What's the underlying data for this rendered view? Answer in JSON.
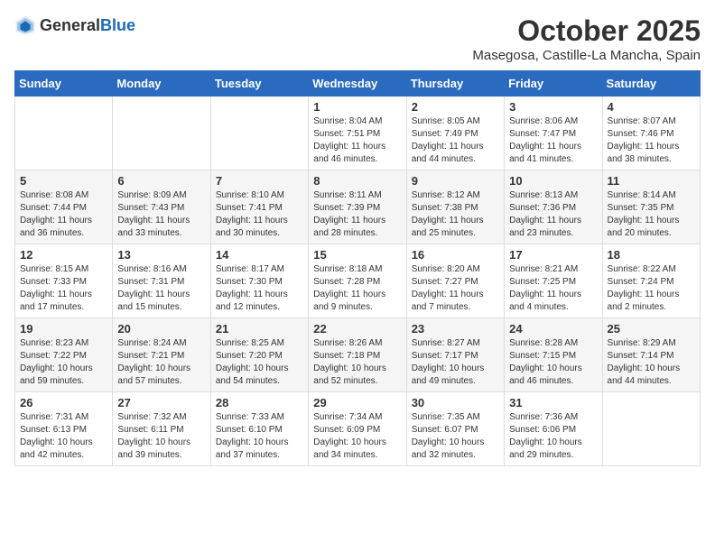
{
  "header": {
    "logo_general": "General",
    "logo_blue": "Blue",
    "title": "October 2025",
    "subtitle": "Masegosa, Castille-La Mancha, Spain"
  },
  "days_of_week": [
    "Sunday",
    "Monday",
    "Tuesday",
    "Wednesday",
    "Thursday",
    "Friday",
    "Saturday"
  ],
  "weeks": [
    [
      {
        "day": "",
        "info": ""
      },
      {
        "day": "",
        "info": ""
      },
      {
        "day": "",
        "info": ""
      },
      {
        "day": "1",
        "info": "Sunrise: 8:04 AM\nSunset: 7:51 PM\nDaylight: 11 hours and 46 minutes."
      },
      {
        "day": "2",
        "info": "Sunrise: 8:05 AM\nSunset: 7:49 PM\nDaylight: 11 hours and 44 minutes."
      },
      {
        "day": "3",
        "info": "Sunrise: 8:06 AM\nSunset: 7:47 PM\nDaylight: 11 hours and 41 minutes."
      },
      {
        "day": "4",
        "info": "Sunrise: 8:07 AM\nSunset: 7:46 PM\nDaylight: 11 hours and 38 minutes."
      }
    ],
    [
      {
        "day": "5",
        "info": "Sunrise: 8:08 AM\nSunset: 7:44 PM\nDaylight: 11 hours and 36 minutes."
      },
      {
        "day": "6",
        "info": "Sunrise: 8:09 AM\nSunset: 7:43 PM\nDaylight: 11 hours and 33 minutes."
      },
      {
        "day": "7",
        "info": "Sunrise: 8:10 AM\nSunset: 7:41 PM\nDaylight: 11 hours and 30 minutes."
      },
      {
        "day": "8",
        "info": "Sunrise: 8:11 AM\nSunset: 7:39 PM\nDaylight: 11 hours and 28 minutes."
      },
      {
        "day": "9",
        "info": "Sunrise: 8:12 AM\nSunset: 7:38 PM\nDaylight: 11 hours and 25 minutes."
      },
      {
        "day": "10",
        "info": "Sunrise: 8:13 AM\nSunset: 7:36 PM\nDaylight: 11 hours and 23 minutes."
      },
      {
        "day": "11",
        "info": "Sunrise: 8:14 AM\nSunset: 7:35 PM\nDaylight: 11 hours and 20 minutes."
      }
    ],
    [
      {
        "day": "12",
        "info": "Sunrise: 8:15 AM\nSunset: 7:33 PM\nDaylight: 11 hours and 17 minutes."
      },
      {
        "day": "13",
        "info": "Sunrise: 8:16 AM\nSunset: 7:31 PM\nDaylight: 11 hours and 15 minutes."
      },
      {
        "day": "14",
        "info": "Sunrise: 8:17 AM\nSunset: 7:30 PM\nDaylight: 11 hours and 12 minutes."
      },
      {
        "day": "15",
        "info": "Sunrise: 8:18 AM\nSunset: 7:28 PM\nDaylight: 11 hours and 9 minutes."
      },
      {
        "day": "16",
        "info": "Sunrise: 8:20 AM\nSunset: 7:27 PM\nDaylight: 11 hours and 7 minutes."
      },
      {
        "day": "17",
        "info": "Sunrise: 8:21 AM\nSunset: 7:25 PM\nDaylight: 11 hours and 4 minutes."
      },
      {
        "day": "18",
        "info": "Sunrise: 8:22 AM\nSunset: 7:24 PM\nDaylight: 11 hours and 2 minutes."
      }
    ],
    [
      {
        "day": "19",
        "info": "Sunrise: 8:23 AM\nSunset: 7:22 PM\nDaylight: 10 hours and 59 minutes."
      },
      {
        "day": "20",
        "info": "Sunrise: 8:24 AM\nSunset: 7:21 PM\nDaylight: 10 hours and 57 minutes."
      },
      {
        "day": "21",
        "info": "Sunrise: 8:25 AM\nSunset: 7:20 PM\nDaylight: 10 hours and 54 minutes."
      },
      {
        "day": "22",
        "info": "Sunrise: 8:26 AM\nSunset: 7:18 PM\nDaylight: 10 hours and 52 minutes."
      },
      {
        "day": "23",
        "info": "Sunrise: 8:27 AM\nSunset: 7:17 PM\nDaylight: 10 hours and 49 minutes."
      },
      {
        "day": "24",
        "info": "Sunrise: 8:28 AM\nSunset: 7:15 PM\nDaylight: 10 hours and 46 minutes."
      },
      {
        "day": "25",
        "info": "Sunrise: 8:29 AM\nSunset: 7:14 PM\nDaylight: 10 hours and 44 minutes."
      }
    ],
    [
      {
        "day": "26",
        "info": "Sunrise: 7:31 AM\nSunset: 6:13 PM\nDaylight: 10 hours and 42 minutes."
      },
      {
        "day": "27",
        "info": "Sunrise: 7:32 AM\nSunset: 6:11 PM\nDaylight: 10 hours and 39 minutes."
      },
      {
        "day": "28",
        "info": "Sunrise: 7:33 AM\nSunset: 6:10 PM\nDaylight: 10 hours and 37 minutes."
      },
      {
        "day": "29",
        "info": "Sunrise: 7:34 AM\nSunset: 6:09 PM\nDaylight: 10 hours and 34 minutes."
      },
      {
        "day": "30",
        "info": "Sunrise: 7:35 AM\nSunset: 6:07 PM\nDaylight: 10 hours and 32 minutes."
      },
      {
        "day": "31",
        "info": "Sunrise: 7:36 AM\nSunset: 6:06 PM\nDaylight: 10 hours and 29 minutes."
      },
      {
        "day": "",
        "info": ""
      }
    ]
  ]
}
